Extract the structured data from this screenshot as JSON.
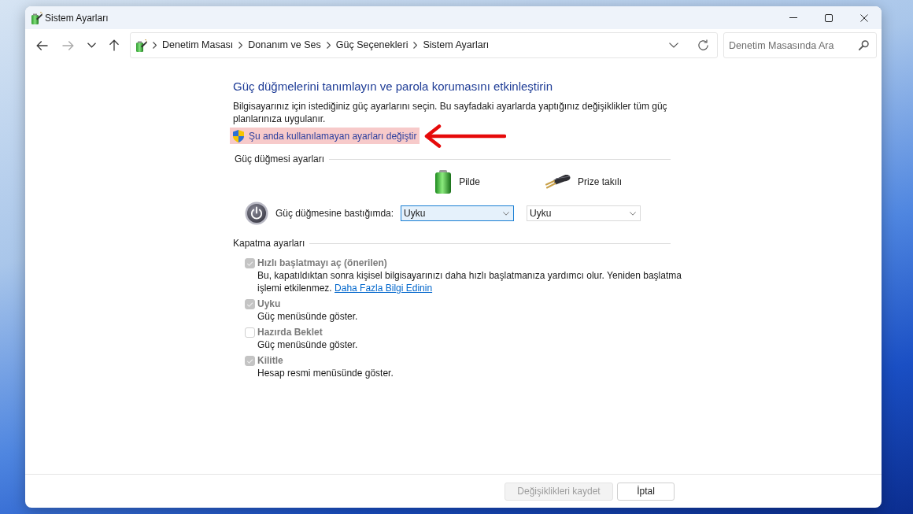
{
  "window": {
    "title": "Sistem Ayarları"
  },
  "nav_buttons": [
    {
      "kind": "back",
      "disabled": false
    },
    {
      "kind": "forward",
      "disabled": true
    },
    {
      "kind": "recent",
      "disabled": false
    },
    {
      "kind": "up",
      "disabled": false
    }
  ],
  "address_bar": {
    "breadcrumb": [
      "Denetim Masası",
      "Donanım ve Ses",
      "Güç Seçenekleri",
      "Sistem Ayarları"
    ]
  },
  "search": {
    "placeholder": "Denetim Masasında Ara"
  },
  "page": {
    "heading": "Güç düğmelerini tanımlayın ve parola korumasını etkinleştirin",
    "description": "Bilgisayarınız için istediğiniz güç ayarlarını seçin. Bu sayfadaki ayarlarda yaptığınız değişiklikler tüm güç planlarınıza uygulanır.",
    "admin_link": {
      "label": "Şu anda kullanılamayan ayarları değiştir",
      "highlighted": true
    }
  },
  "power_button_settings": {
    "title": "Güç düğmesi ayarları",
    "columns": [
      {
        "kind": "battery",
        "label": "Pilde"
      },
      {
        "kind": "plugged",
        "label": "Prize takılı"
      }
    ],
    "rows": [
      {
        "label": "Güç düğmesine bastığımda:",
        "values": [
          {
            "value": "Uyku",
            "focused": true
          },
          {
            "value": "Uyku",
            "focused": false
          }
        ]
      }
    ]
  },
  "shutdown_settings": {
    "title": "Kapatma ayarları",
    "options": [
      {
        "label": "Hızlı başlatmayı aç (önerilen)",
        "checked": true,
        "disabled": true,
        "description": "Bu, kapatıldıktan sonra kişisel bilgisayarınızı daha hızlı başlatmanıza yardımcı olur. Yeniden başlatma işlemi etkilenmez.",
        "link": "Daha Fazla Bilgi Edinin"
      },
      {
        "label": "Uyku",
        "checked": true,
        "disabled": true,
        "description": "Güç menüsünde göster."
      },
      {
        "label": "Hazırda Beklet",
        "checked": false,
        "disabled": true,
        "description": "Güç menüsünde göster."
      },
      {
        "label": "Kilitle",
        "checked": true,
        "disabled": true,
        "description": "Hesap resmi menüsünde göster."
      }
    ]
  },
  "buttons": [
    {
      "label": "Değişiklikleri kaydet",
      "disabled": true
    },
    {
      "label": "İptal",
      "disabled": false
    }
  ]
}
